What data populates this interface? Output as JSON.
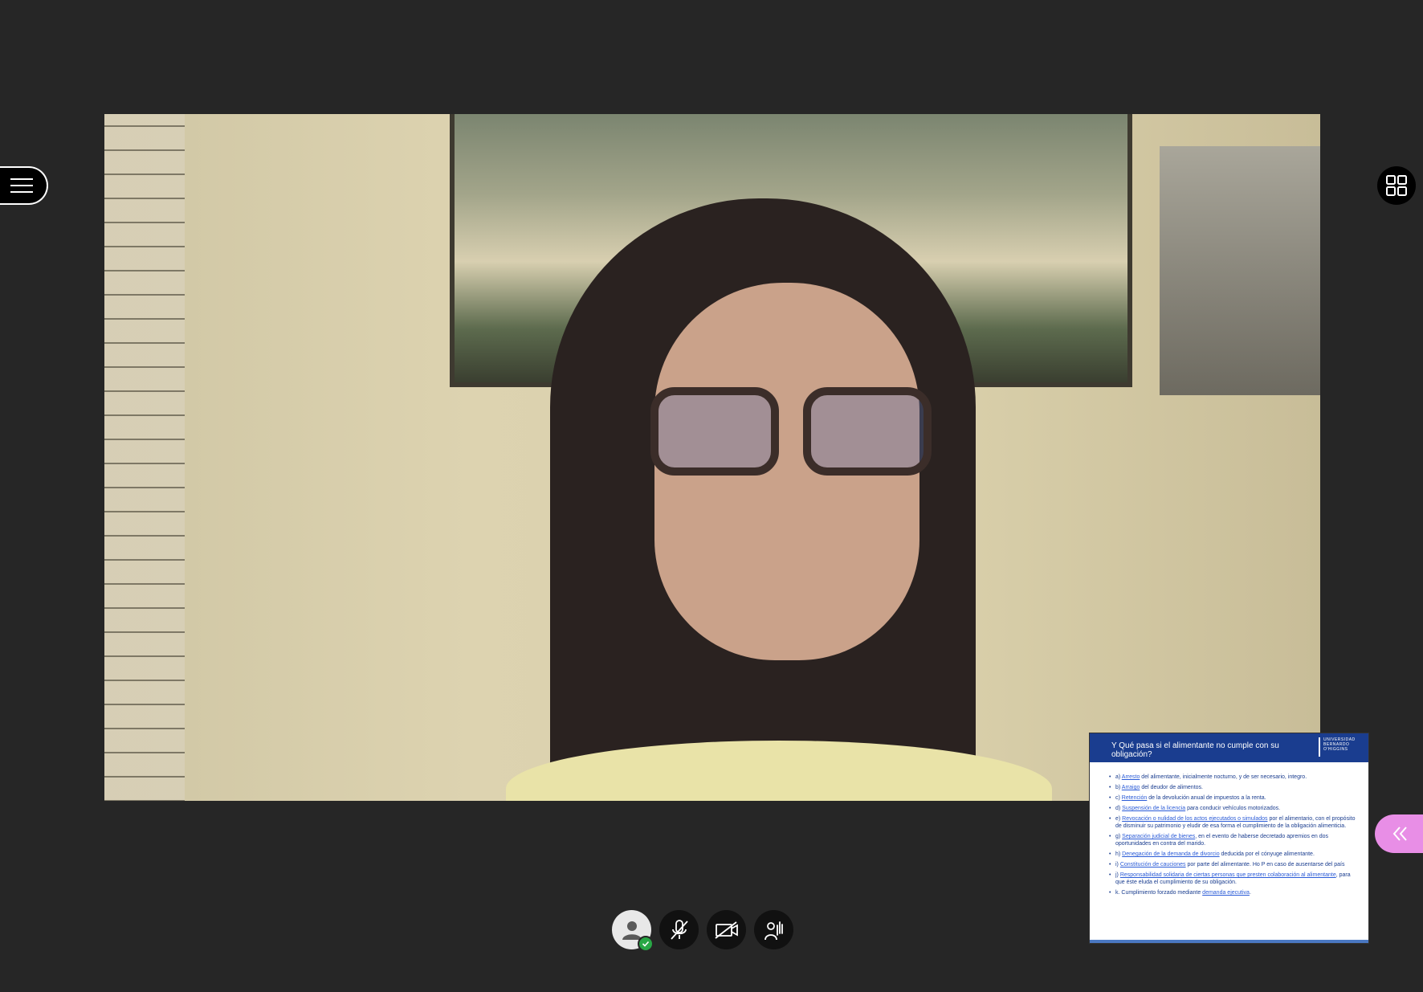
{
  "controls": {
    "menu_icon": "hamburger-menu-icon",
    "grid_icon": "grid-layout-icon",
    "avatar_icon": "user-avatar-icon",
    "mic_icon": "microphone-muted-icon",
    "camera_icon": "camera-off-icon",
    "hand_icon": "raise-hand-icon",
    "collapse_icon": "chevron-double-left-icon"
  },
  "colors": {
    "background": "#262626",
    "slide_header": "#1a3d8f",
    "collapse_tab": "#e88ee6",
    "status_ok": "#28a745"
  },
  "slide": {
    "title": "Y Qué pasa si el alimentante no cumple con su obligación?",
    "logo_line1": "UNIVERSIDAD",
    "logo_line2": "BERNARDO",
    "logo_line3": "O'HIGGINS",
    "items": [
      {
        "prefix": "a) ",
        "link": "Arresto",
        "rest": " del alimentante, inicialmente nocturno, y de ser necesario, integro."
      },
      {
        "prefix": "b) ",
        "link": "Arraigo",
        "rest": " del deudor de alimentos."
      },
      {
        "prefix": "c) ",
        "link": "Retención",
        "rest": " de la devolución anual de impuestos a la renta."
      },
      {
        "prefix": "d) ",
        "link": "Suspensión de la licencia",
        "rest": " para conducir vehículos motorizados."
      },
      {
        "prefix": "e) ",
        "link": "Revocación o nulidad de los actos ejecutados o simulados",
        "rest": " por el alimentario, con el propósito de disminuir su patrimonio y eludir de esa forma el cumplimiento de la obligación alimenticia."
      },
      {
        "prefix": "g) ",
        "link": "Separación judicial de bienes",
        "rest": ", en el evento de haberse decretado apremios en dos oportunidades en contra del marido."
      },
      {
        "prefix": "h) ",
        "link": "Denegación de la demanda de divorcio",
        "rest": " deducida por el cónyuge alimentante."
      },
      {
        "prefix": "i) ",
        "link": "Constitución de cauciones",
        "rest": " por parte del alimentante. Ho P en caso de ausentarse del país"
      },
      {
        "prefix": "j) ",
        "link": "Responsabilidad solidaria de ciertas personas que presten colaboración al alimentante",
        "rest": ", para que éste eluda el cumplimiento de su obligación."
      },
      {
        "prefix": "k. Cumplimiento forzado mediante ",
        "link": "demanda ejecutiva",
        "rest": "."
      }
    ]
  }
}
